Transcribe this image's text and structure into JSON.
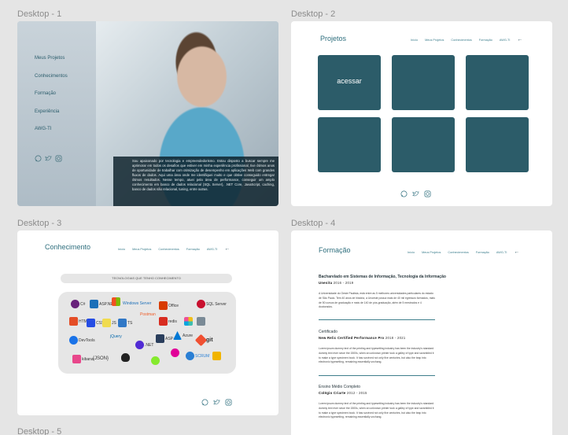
{
  "frames": {
    "desktop1": {
      "label": "Desktop - 1",
      "menu": [
        "Meus Projetos",
        "Conhecimentos",
        "Formação",
        "Experiência",
        "AWG-TI"
      ],
      "bio": "Sou apaixonado por tecnologia e empreendedorismo. Estou disposto a buscar sempre me aprimorar em todos os desafios que estiver em minha experiência profissional, tive ótimos anos de oportunidade de trabalhar com otimização de desempenho em aplicações Web com grandes fluxos de dados. Aqui uma área onde me identifiquei muito e que obtive conseguido entregar ótimos resultados. Nesse tempo, atuei pela área de performance, conseguir um amplo conhecimento em banco de dados relacional (SQL Server), .NET Core, JavaScript, caching, banco de dados não relacional, tuning, entre outras."
    },
    "desktop2": {
      "label": "Desktop - 2",
      "title": "Projetos",
      "tile_label": "acessar"
    },
    "desktop3": {
      "label": "Desktop - 3",
      "title": "Conhecimento",
      "pill": "TECNOLOGIAS QUE TENHO CONHECIMENTO",
      "logos": [
        "C#",
        "ASP.NET",
        "Windows Server",
        "Office",
        "SQL Server",
        "HTML",
        "CSS",
        "JS",
        "TS",
        "Postman",
        "redis",
        "Azure",
        "DevTools",
        "jQuery",
        ".NET",
        "ASP",
        "git",
        "kibana",
        "{JSON}",
        "Linux",
        "GraphQL",
        "Swagger",
        "SCRUM"
      ]
    },
    "desktop4": {
      "label": "Desktop - 4",
      "title": "Formação",
      "sections": [
        {
          "title": "Bacharelado em Sistemas de Informação, Tecnologia da Informação",
          "school": "Unesita",
          "years": "2016 - 2019",
          "text": "A Universidade do Oeste Paulista, está entre as 5 melhores universidades particulares do estado de São Paulo. Tem 40 anos de história, a Unoeste possui mais de 40 mil egressos formados, mais de 50 cursos de graduação e mais de 140 de pós-graduação, além de 5 mestrados e 4 doutorados."
        },
        {
          "title": "Certificado",
          "school": "New Relic Certified Performance Pro",
          "years": "2018 - 2021",
          "text": "Lorem ipsum dummy text of the printing and typesetting industry has been the industry's standard dummy text ever since the 1500s, when an unknown printer took a galley of type and scrambled it to make a type specimen book. It has survived not only five centuries, but also the leap into electronic typesetting, remaining essentially unchang."
        },
        {
          "title": "Ensino Médio Completo",
          "school": "Colégio Criarte",
          "years": "2012 - 2015",
          "text": "Lorem ipsum dummy text of the printing and typesetting industry has been the industry's standard dummy text ever since the 1500s, when an unknown printer took a galley of type and scrambled it to make a type specimen book. It has survived not only five centuries, but also the leap into electronic typesetting, remaining essentially unchang."
        }
      ]
    },
    "desktop5": {
      "label": "Desktop - 5"
    }
  },
  "nav": [
    "Início",
    "Meus Projetos",
    "Conhecimentos",
    "Formação",
    "AWG-TI"
  ],
  "colors": {
    "accent": "#2f6f7e",
    "tile": "#2c5c69"
  },
  "icons": [
    "whatsapp-icon",
    "twitter-icon",
    "instagram-icon",
    "back-arrow-icon"
  ]
}
